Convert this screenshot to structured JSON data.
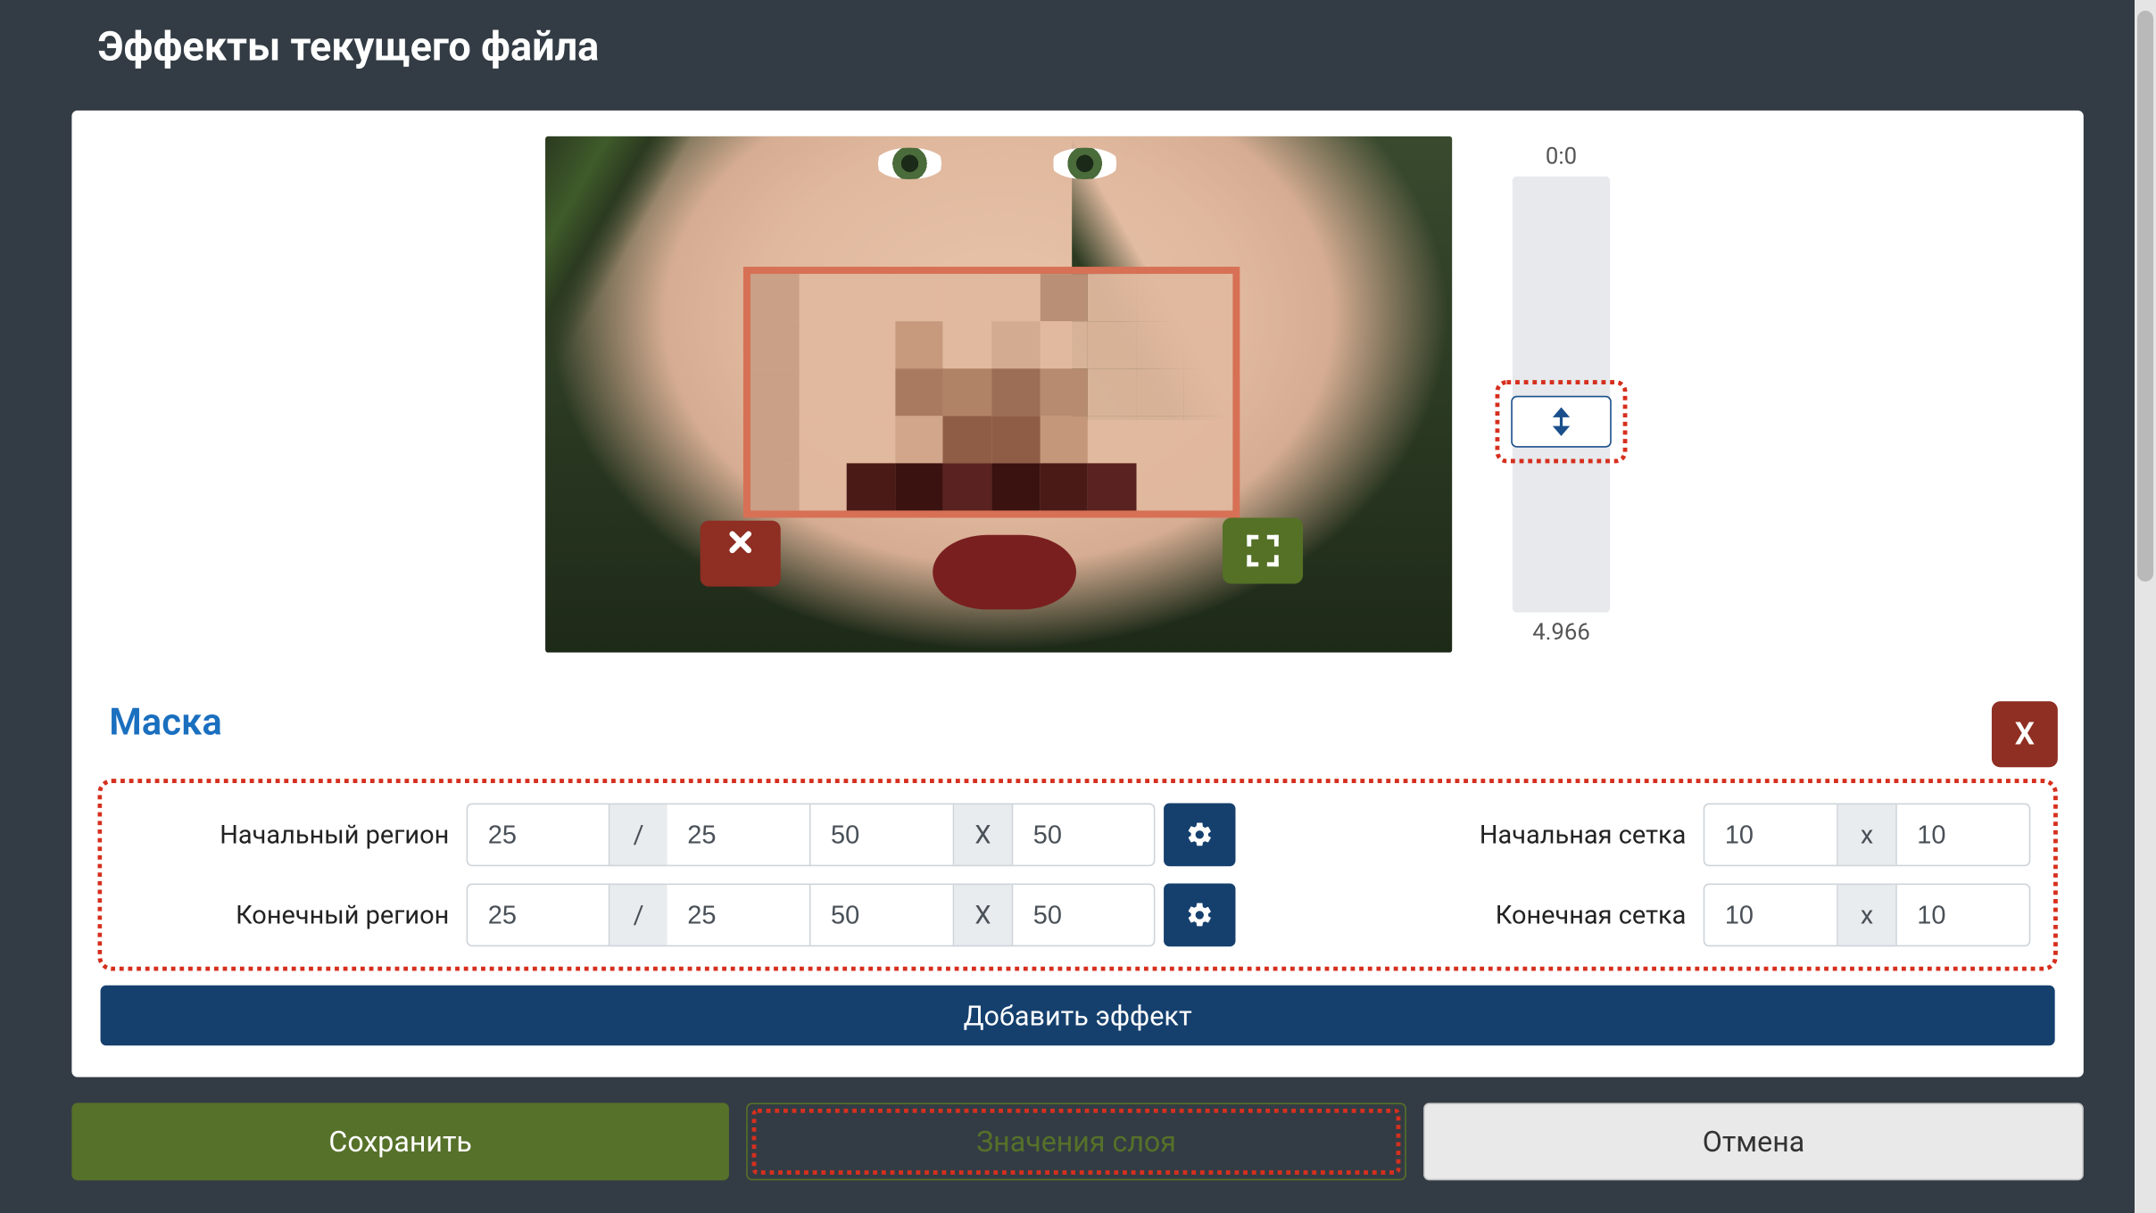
{
  "title": "Эффекты текущего файла",
  "slider": {
    "top": "0:0",
    "bottom": "4.966"
  },
  "mask": {
    "title": "Маска",
    "close_label": "X",
    "start_region_label": "Начальный регион",
    "end_region_label": "Конечный регион",
    "start_grid_label": "Начальная сетка",
    "end_grid_label": "Конечная сетка",
    "start_region": {
      "x": "25",
      "y": "25",
      "w": "50",
      "h": "50"
    },
    "end_region": {
      "x": "25",
      "y": "25",
      "w": "50",
      "h": "50"
    },
    "start_grid": {
      "cols": "10",
      "rows": "10"
    },
    "end_grid": {
      "cols": "10",
      "rows": "10"
    },
    "sep_slash": "/",
    "sep_x_upper": "X",
    "sep_x_lower": "x"
  },
  "add_effect_label": "Добавить эффект",
  "footer": {
    "save": "Сохранить",
    "layer_values": "Значения слоя",
    "cancel": "Отмена"
  }
}
